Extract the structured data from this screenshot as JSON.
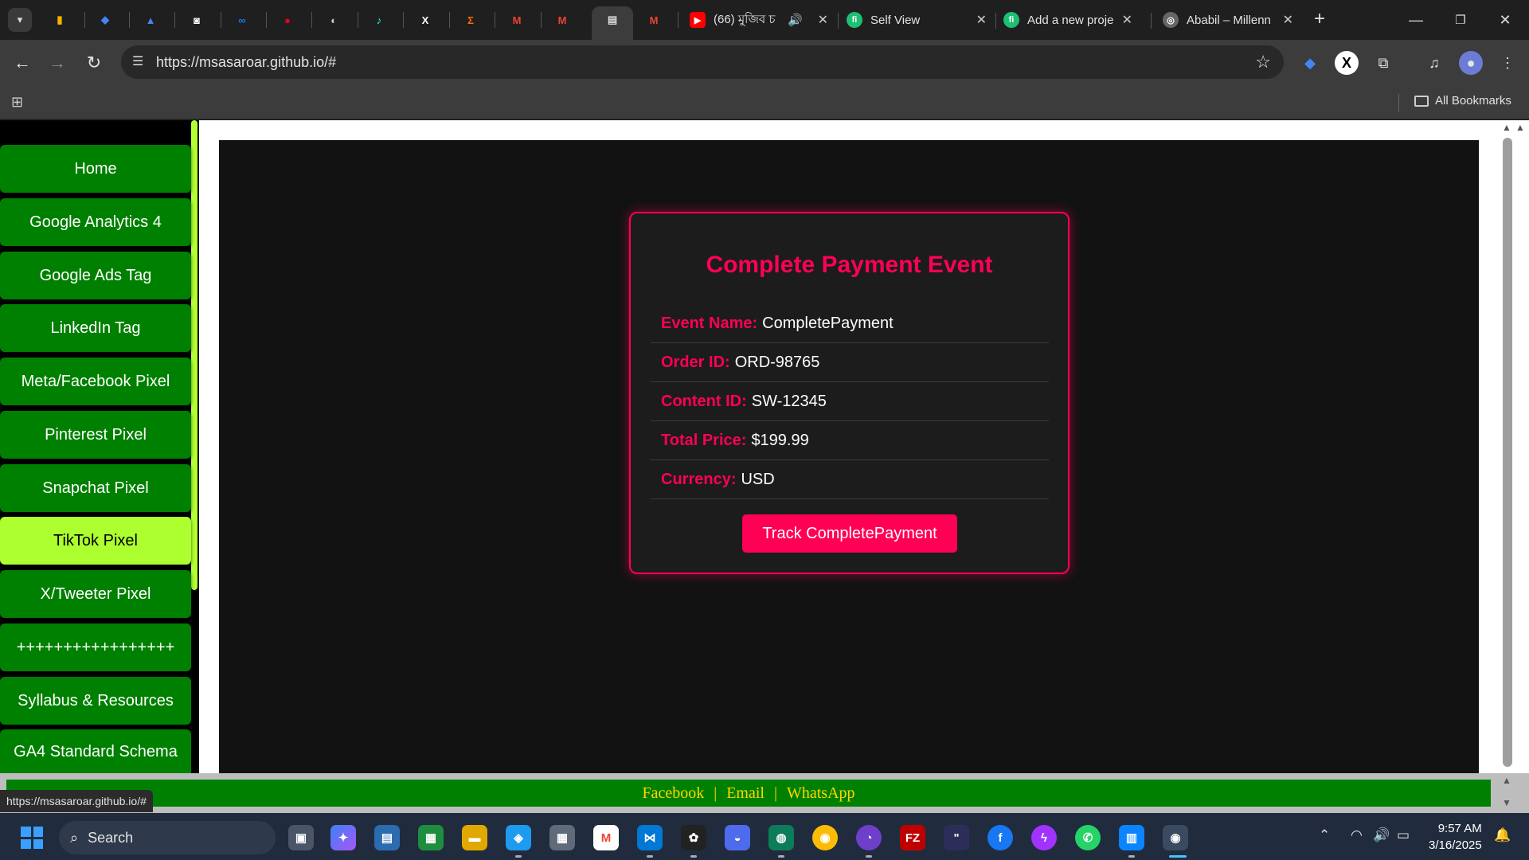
{
  "browser": {
    "tabs": [
      {
        "title": "(66) মুজিব চ",
        "muted_icon": "speaker-icon"
      },
      {
        "title": "Self View"
      },
      {
        "title": "Add a new proje"
      },
      {
        "title": "Ababil – Millenn"
      }
    ],
    "url": "https://msasaroar.github.io/#",
    "bookmarks_label": "All Bookmarks",
    "status_url": "https://msasaroar.github.io/#"
  },
  "sidebar": {
    "items": [
      {
        "label": "Home"
      },
      {
        "label": "Google Analytics 4"
      },
      {
        "label": "Google Ads Tag"
      },
      {
        "label": "LinkedIn Tag"
      },
      {
        "label": "Meta/Facebook Pixel"
      },
      {
        "label": "Pinterest Pixel"
      },
      {
        "label": "Snapchat Pixel"
      },
      {
        "label": "TikTok Pixel",
        "active": true
      },
      {
        "label": "X/Tweeter Pixel"
      },
      {
        "label": "+++++++++++++++++"
      },
      {
        "label": "Syllabus & Resources"
      },
      {
        "label": "GA4 Standard Schema"
      }
    ]
  },
  "card": {
    "title": "Complete Payment Event",
    "fields": [
      {
        "key": "Event Name:",
        "value": "CompletePayment"
      },
      {
        "key": "Order ID:",
        "value": "ORD-98765"
      },
      {
        "key": "Content ID:",
        "value": "SW-12345"
      },
      {
        "key": "Total Price:",
        "value": "$199.99"
      },
      {
        "key": "Currency:",
        "value": "USD"
      }
    ],
    "button": "Track CompletePayment"
  },
  "footer": {
    "links": [
      "Facebook",
      "Email",
      "WhatsApp"
    ],
    "separator": "|"
  },
  "taskbar": {
    "search": "Search",
    "time": "9:57 AM",
    "date": "3/16/2025"
  },
  "colors": {
    "accent": "#ff0055",
    "nav_green": "#008000",
    "nav_active": "#adff2f",
    "footer_link": "#ffd700"
  }
}
